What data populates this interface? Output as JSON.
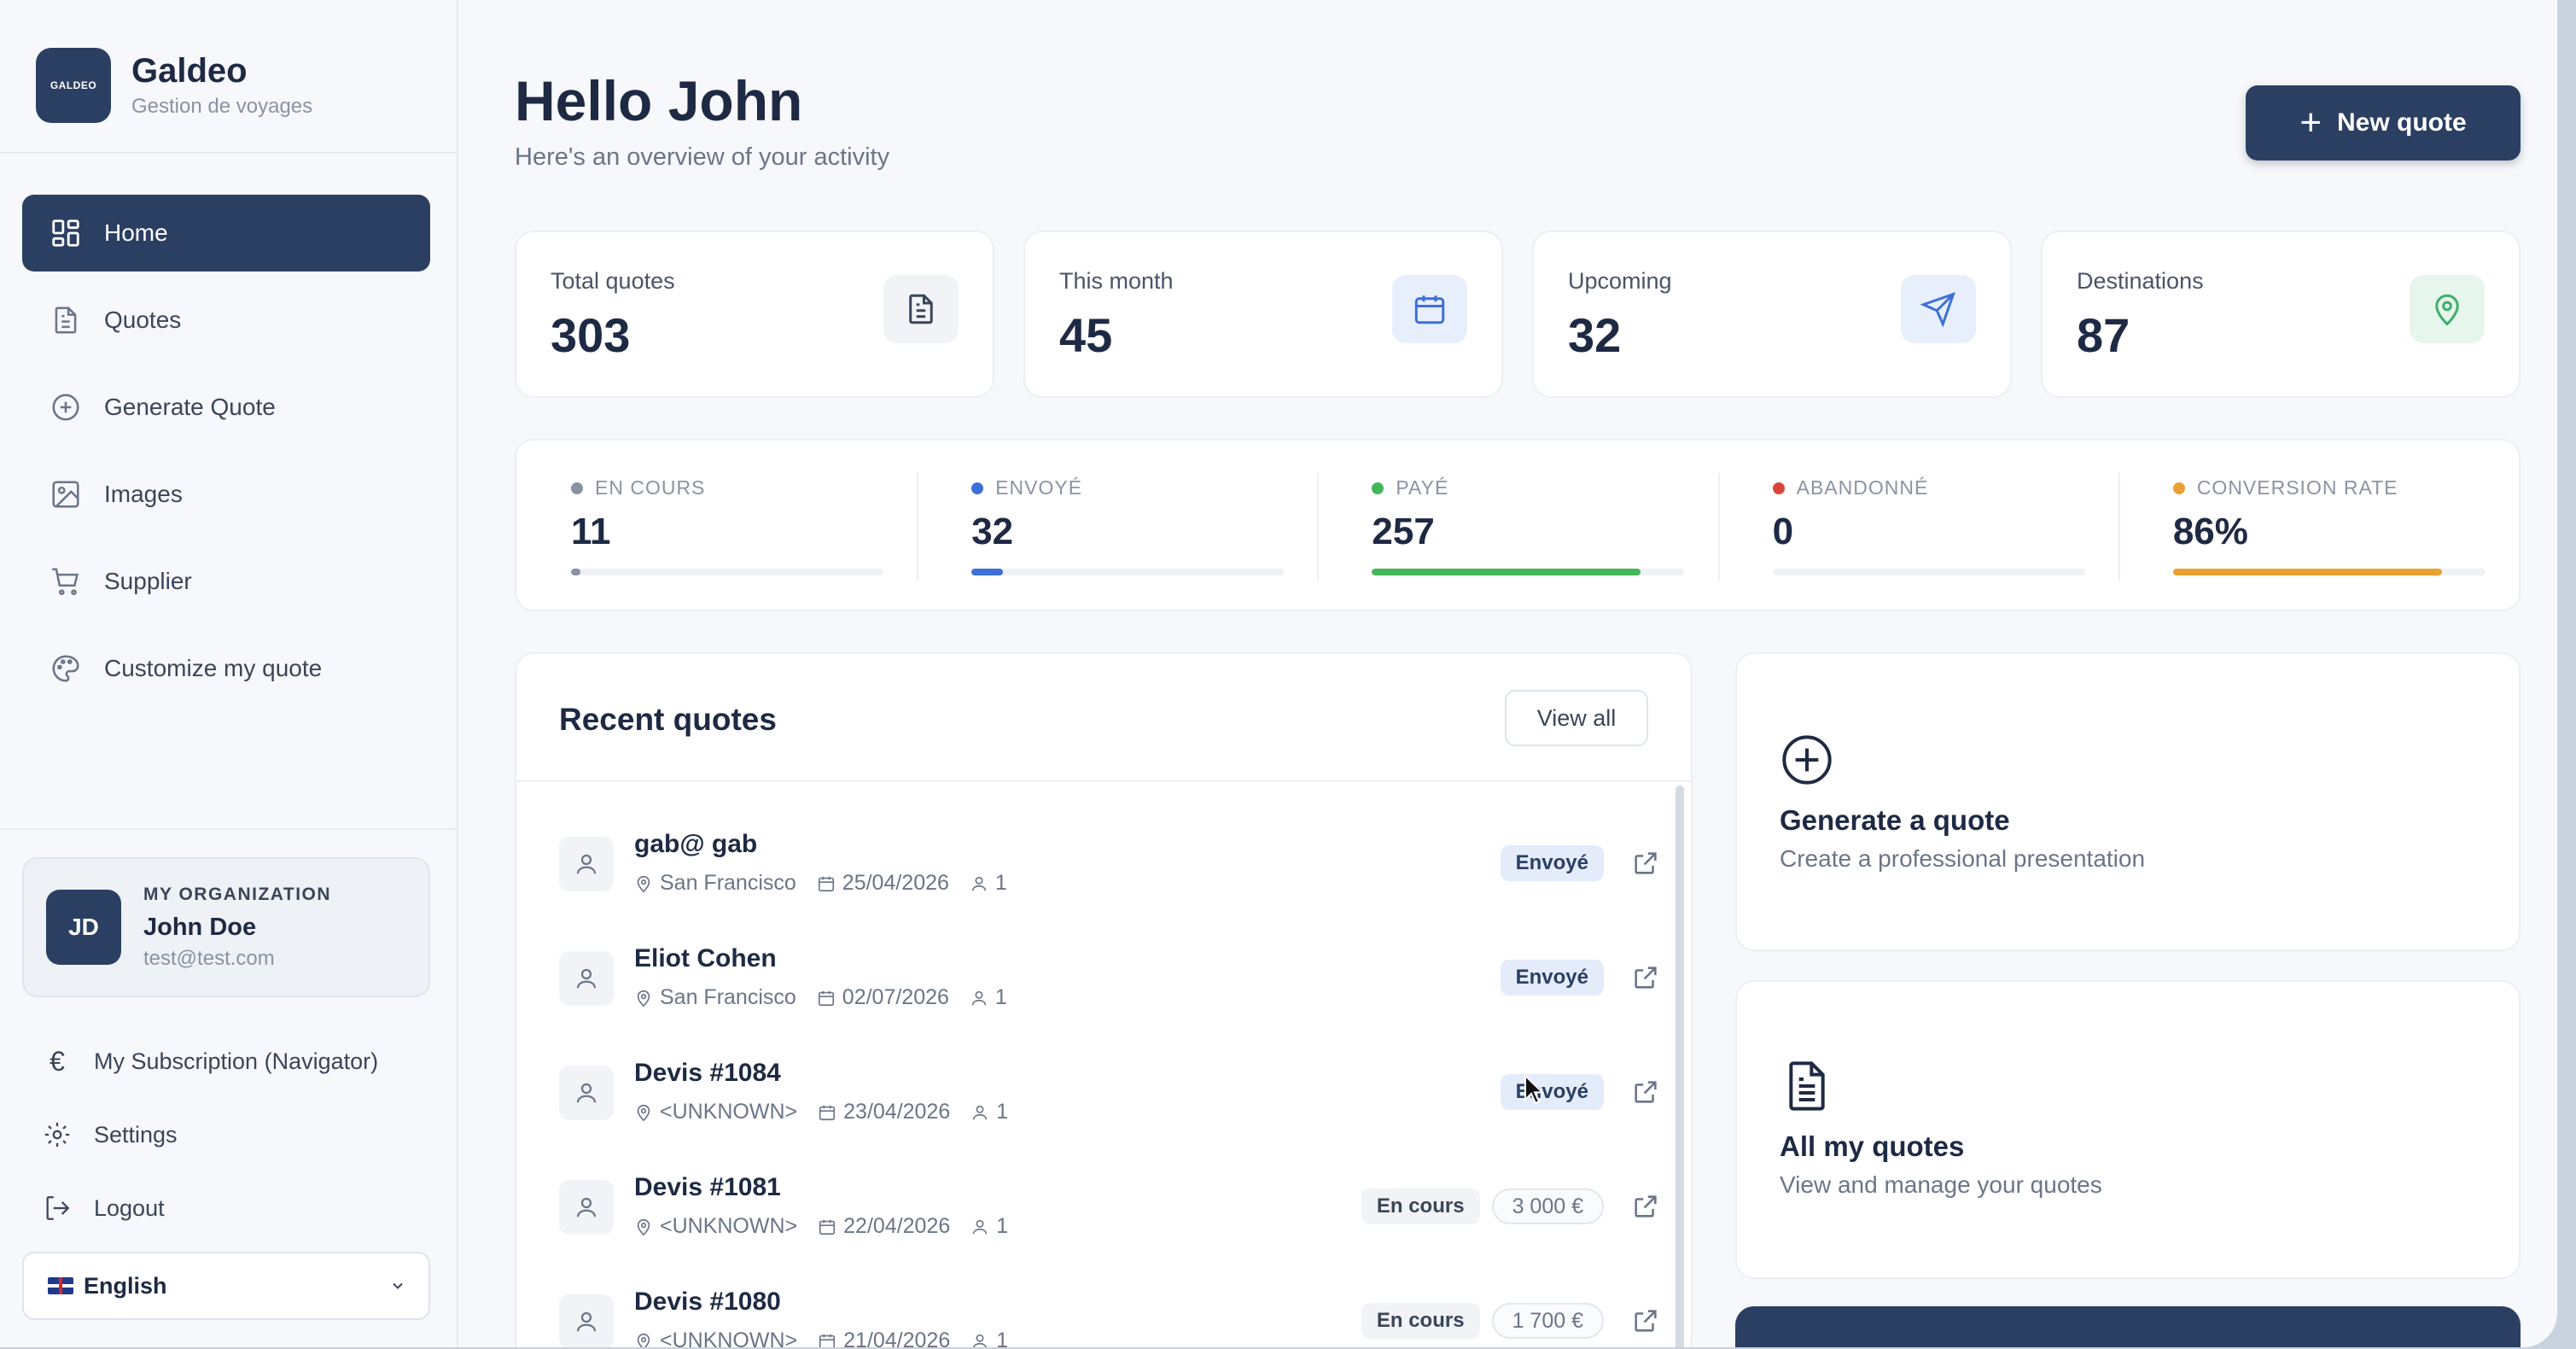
{
  "brand": {
    "logo_text": "GALDEO",
    "name": "Galdeo",
    "subtitle": "Gestion de voyages"
  },
  "nav": [
    {
      "label": "Home",
      "icon": "grid-icon",
      "active": true
    },
    {
      "label": "Quotes",
      "icon": "document-icon"
    },
    {
      "label": "Generate Quote",
      "icon": "plus-circle-icon"
    },
    {
      "label": "Images",
      "icon": "image-icon"
    },
    {
      "label": "Supplier",
      "icon": "cart-icon"
    },
    {
      "label": "Customize my quote",
      "icon": "palette-icon"
    }
  ],
  "organization": {
    "label": "MY ORGANIZATION",
    "initials": "JD",
    "name": "John Doe",
    "email": "test@test.com"
  },
  "bottom_links": {
    "subscription": "My Subscription (Navigator)",
    "settings": "Settings",
    "logout": "Logout"
  },
  "language": {
    "selected": "English"
  },
  "header": {
    "title": "Hello John",
    "subtitle": "Here's an overview of your activity",
    "new_quote_label": "New quote"
  },
  "stats": [
    {
      "label": "Total quotes",
      "value": "303",
      "icon": "document-icon",
      "icon_bg": "#f1f3f6",
      "icon_color": "#3a4558"
    },
    {
      "label": "This month",
      "value": "45",
      "icon": "calendar-icon",
      "icon_bg": "#e8effc",
      "icon_color": "#3d6fd8"
    },
    {
      "label": "Upcoming",
      "value": "32",
      "icon": "send-icon",
      "icon_bg": "#e8effc",
      "icon_color": "#3d6fd8"
    },
    {
      "label": "Destinations",
      "value": "87",
      "icon": "map-pin-icon",
      "icon_bg": "#e6f6ec",
      "icon_color": "#3fae68"
    }
  ],
  "statuses": [
    {
      "label": "EN COURS",
      "value": "11",
      "color": "#8a93a3",
      "progress": 0.03
    },
    {
      "label": "ENVOYÉ",
      "value": "32",
      "color": "#3d6fd8",
      "progress": 0.1
    },
    {
      "label": "PAYÉ",
      "value": "257",
      "color": "#43b65a",
      "progress": 0.86
    },
    {
      "label": "ABANDONNÉ",
      "value": "0",
      "color": "#d9443a",
      "progress": 0
    },
    {
      "label": "CONVERSION RATE",
      "value": "86%",
      "color": "#eaa033",
      "progress": 0.86
    }
  ],
  "recent": {
    "title": "Recent quotes",
    "view_all": "View all",
    "rows": [
      {
        "name": "gab@ gab",
        "location": "San Francisco",
        "date": "25/04/2026",
        "people": "1",
        "status": "Envoyé",
        "status_type": "sent",
        "price": ""
      },
      {
        "name": "Eliot Cohen",
        "location": "San Francisco",
        "date": "02/07/2026",
        "people": "1",
        "status": "Envoyé",
        "status_type": "sent",
        "price": ""
      },
      {
        "name": "Devis #1084",
        "location": "<UNKNOWN>",
        "date": "23/04/2026",
        "people": "1",
        "status": "Envoyé",
        "status_type": "sent",
        "price": ""
      },
      {
        "name": "Devis #1081",
        "location": "<UNKNOWN>",
        "date": "22/04/2026",
        "people": "1",
        "status": "En cours",
        "status_type": "inprog",
        "price": "3 000 €"
      },
      {
        "name": "Devis #1080",
        "location": "<UNKNOWN>",
        "date": "21/04/2026",
        "people": "1",
        "status": "En cours",
        "status_type": "inprog",
        "price": "1 700 €"
      }
    ]
  },
  "actions": [
    {
      "title": "Generate a quote",
      "subtitle": "Create a professional presentation",
      "icon": "plus-circle-icon"
    },
    {
      "title": "All my quotes",
      "subtitle": "View and manage your quotes",
      "icon": "document-icon"
    }
  ]
}
